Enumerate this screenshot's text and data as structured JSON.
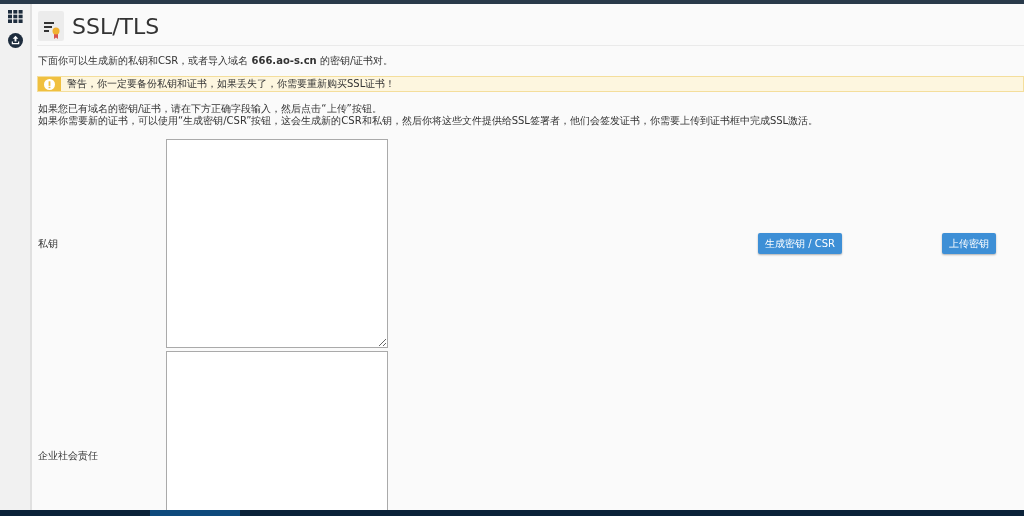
{
  "page": {
    "title": "SSL/TLS"
  },
  "intro": "下面你可以生成新的私钥和CSR，或者导入域名 **666.ao-s.cn** 的密钥/证书对。",
  "alert": {
    "kind": "warning",
    "text": "警告，你一定要备份私钥和证书，如果丢失了，你需要重新购买SSL证书！"
  },
  "instructions": [
    "如果您已有域名的密钥/证书，请在下方正确字段输入，然后点击“上传”按钮。",
    "如果你需要新的证书，可以使用“生成密钥/CSR”按钮，这会生成新的CSR和私钥，然后你将这些文件提供给SSL签署者，他们会签发证书，你需要上传到证书框中完成SSL激活。"
  ],
  "fields": [
    {
      "label": "私钥",
      "buttons": [
        "生成密钥 / CSR",
        "上传密钥"
      ]
    },
    {
      "label": "企业社会责任"
    }
  ]
}
